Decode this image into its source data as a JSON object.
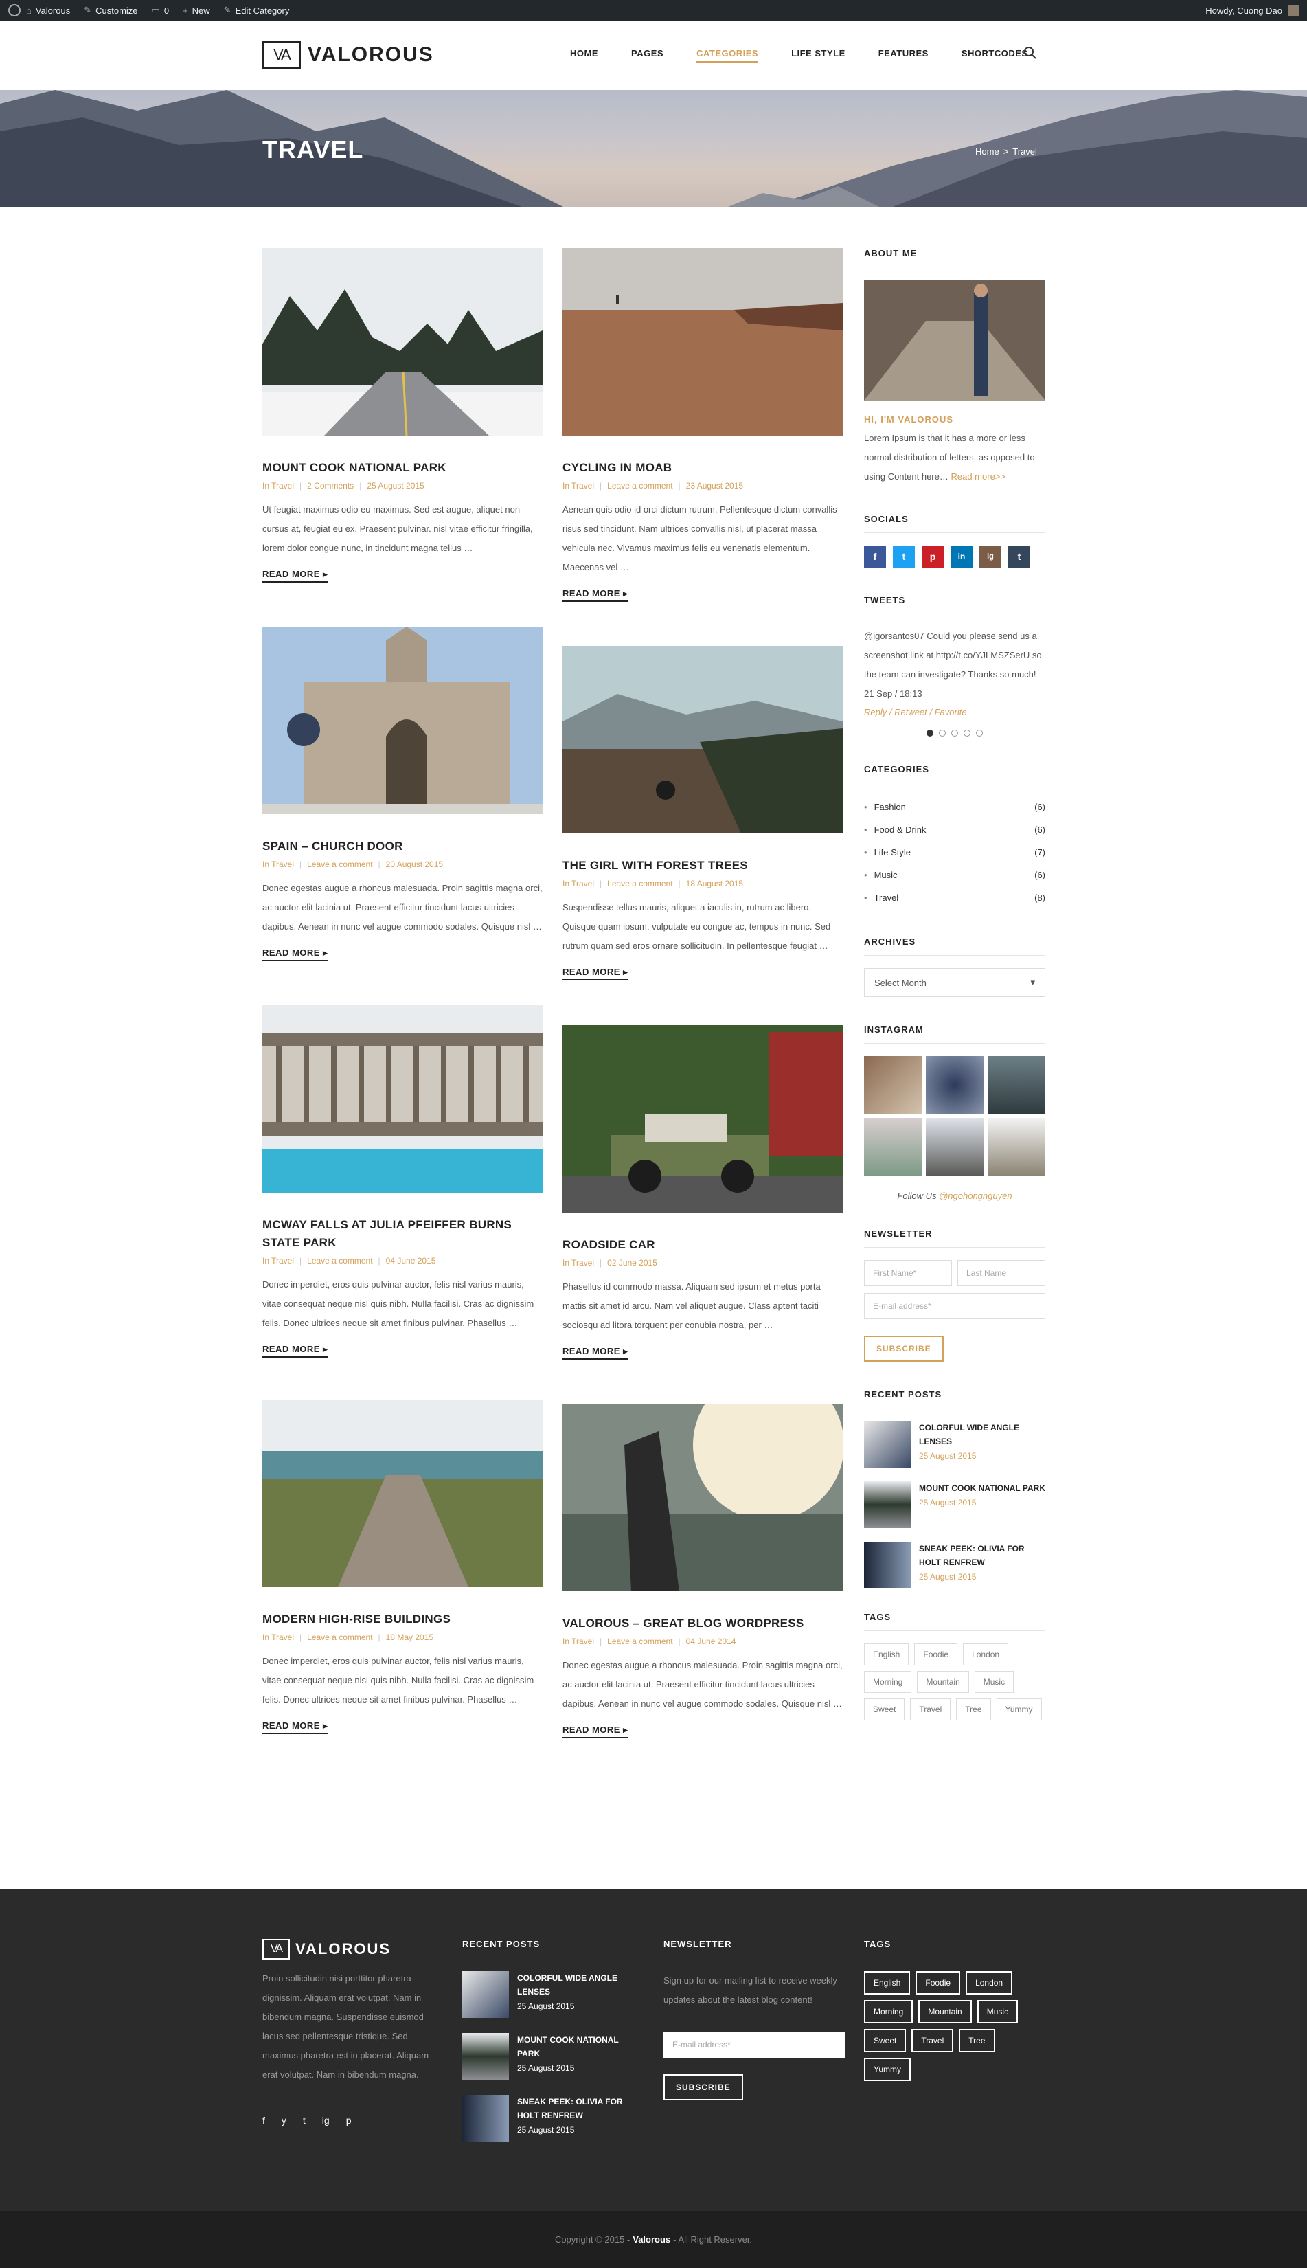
{
  "adminbar": {
    "site": "Valorous",
    "customize": "Customize",
    "comments": "0",
    "new": "New",
    "edit": "Edit Category",
    "howdy": "Howdy, Cuong Dao"
  },
  "header": {
    "logo_mark": "VA",
    "logo_text": "VALOROUS",
    "nav": [
      "HOME",
      "PAGES",
      "CATEGORIES",
      "LIFE STYLE",
      "FEATURES",
      "SHORTCODES"
    ],
    "active": "CATEGORIES"
  },
  "hero": {
    "title": "TRAVEL",
    "crumb_home": "Home",
    "crumb_sep": ">",
    "crumb_current": "Travel"
  },
  "posts": [
    {
      "title": "MOUNT COOK NATIONAL PARK",
      "cat": "In Travel",
      "comments": "2 Comments",
      "date": "25 August 2015",
      "excerpt": "Ut feugiat maximus odio eu maximus. Sed est augue, aliquet non cursus at, feugiat eu ex. Praesent pulvinar. nisl vitae efficitur fringilla, lorem dolor congue nunc, in tincidunt magna tellus …",
      "more": "READ MORE"
    },
    {
      "title": "CYCLING IN MOAB",
      "cat": "In Travel",
      "comments": "Leave a comment",
      "date": "23 August 2015",
      "excerpt": "Aenean quis odio id orci dictum rutrum. Pellentesque dictum convallis risus sed tincidunt. Nam ultrices convallis nisl, ut placerat massa vehicula nec. Vivamus maximus felis eu venenatis elementum. Maecenas vel …",
      "more": "READ MORE"
    },
    {
      "title": "SPAIN – CHURCH DOOR",
      "cat": "In Travel",
      "comments": "Leave a comment",
      "date": "20 August 2015",
      "excerpt": "Donec egestas augue a rhoncus malesuada. Proin sagittis magna orci, ac auctor elit lacinia ut. Praesent efficitur tincidunt lacus ultricies dapibus. Aenean in nunc vel augue commodo sodales. Quisque nisl …",
      "more": "READ MORE"
    },
    {
      "title": "THE GIRL WITH FOREST TREES",
      "cat": "In Travel",
      "comments": "Leave a comment",
      "date": "18 August 2015",
      "excerpt": "Suspendisse tellus mauris, aliquet a iaculis in, rutrum ac libero. Quisque quam ipsum, vulputate eu congue ac, tempus in nunc. Sed rutrum quam sed eros ornare sollicitudin. In pellentesque feugiat …",
      "more": "READ MORE"
    },
    {
      "title": "MCWAY FALLS AT JULIA PFEIFFER BURNS STATE PARK",
      "cat": "In Travel",
      "comments": "Leave a comment",
      "date": "04 June 2015",
      "excerpt": "Donec imperdiet, eros quis pulvinar auctor, felis nisl varius mauris, vitae consequat neque nisl quis nibh. Nulla facilisi. Cras ac dignissim felis. Donec ultrices neque sit amet finibus pulvinar. Phasellus …",
      "more": "READ MORE"
    },
    {
      "title": "ROADSIDE CAR",
      "cat": "In Travel",
      "comments": "",
      "date": "02 June 2015",
      "excerpt": "Phasellus id commodo massa. Aliquam sed ipsum et metus porta mattis sit amet id arcu. Nam vel aliquet augue. Class aptent taciti sociosqu ad litora torquent per conubia nostra, per …",
      "more": "READ MORE"
    },
    {
      "title": "MODERN HIGH-RISE BUILDINGS",
      "cat": "In Travel",
      "comments": "Leave a comment",
      "date": "18 May 2015",
      "excerpt": "Donec imperdiet, eros quis pulvinar auctor, felis nisl varius mauris, vitae consequat neque nisl quis nibh. Nulla facilisi. Cras ac dignissim felis. Donec ultrices neque sit amet finibus pulvinar. Phasellus …",
      "more": "READ MORE"
    },
    {
      "title": "VALOROUS – GREAT BLOG WORDPRESS",
      "cat": "In Travel",
      "comments": "Leave a comment",
      "date": "04 June 2014",
      "excerpt": "Donec egestas augue a rhoncus malesuada. Proin sagittis magna orci, ac auctor elit lacinia ut. Praesent efficitur tincidunt lacus ultricies dapibus. Aenean in nunc vel augue commodo sodales. Quisque nisl …",
      "more": "READ MORE"
    }
  ],
  "sidebar": {
    "about_title": "ABOUT ME",
    "about_heading": "HI, I'M VALOROUS",
    "about_text": "Lorem Ipsum is that it has a more or less normal distribution of letters, as opposed to using Content here…",
    "about_link": "Read more>>",
    "socials_title": "SOCIALS",
    "socials": [
      "f",
      "t",
      "p",
      "in",
      "ig",
      "t"
    ],
    "tweets_title": "TWEETS",
    "tweet_text": "@igorsantos07 Could you please send us a screenshot link at http://t.co/YJLMSZSerU so the team can investigate? Thanks so much!",
    "tweet_date": "21 Sep / 18:13",
    "tweet_actions": "Reply / Retweet / Favorite",
    "categories_title": "CATEGORIES",
    "categories": [
      {
        "name": "Fashion",
        "count": "(6)"
      },
      {
        "name": "Food & Drink",
        "count": "(6)"
      },
      {
        "name": "Life Style",
        "count": "(7)"
      },
      {
        "name": "Music",
        "count": "(6)"
      },
      {
        "name": "Travel",
        "count": "(8)"
      }
    ],
    "archives_title": "ARCHIVES",
    "archives_select": "Select Month",
    "instagram_title": "INSTAGRAM",
    "follow_prefix": "Follow Us",
    "follow_handle": "@ngohongnguyen",
    "newsletter_title": "NEWSLETTER",
    "first_name": "First Name*",
    "last_name": "Last Name",
    "email": "E-mail address*",
    "subscribe": "SUBSCRIBE",
    "recent_title": "RECENT POSTS",
    "recent": [
      {
        "title": "COLORFUL WIDE ANGLE LENSES",
        "date": "25 August 2015"
      },
      {
        "title": "MOUNT COOK NATIONAL PARK",
        "date": "25 August 2015"
      },
      {
        "title": "SNEAK PEEK: OLIVIA FOR HOLT RENFREW",
        "date": "25 August 2015"
      }
    ],
    "tags_title": "TAGS",
    "tags": [
      "English",
      "Foodie",
      "London",
      "Morning",
      "Mountain",
      "Music",
      "Sweet",
      "Travel",
      "Tree",
      "Yummy"
    ]
  },
  "footer": {
    "logo_mark": "VA",
    "logo_text": "VALOROUS",
    "about": "Proin sollicitudin nisi porttitor pharetra dignissim. Aliquam erat volutpat. Nam in bibendum magna. Suspendisse euismod lacus sed pellentesque tristique. Sed maximus pharetra est in placerat. Aliquam erat volutpat. Nam in bibendum magna.",
    "social": [
      "f",
      "y",
      "t",
      "ig",
      "p"
    ],
    "recent_title": "RECENT POSTS",
    "recent": [
      {
        "title": "COLORFUL WIDE ANGLE LENSES",
        "date": "25 August 2015"
      },
      {
        "title": "MOUNT COOK NATIONAL PARK",
        "date": "25 August 2015"
      },
      {
        "title": "SNEAK PEEK: OLIVIA FOR HOLT RENFREW",
        "date": "25 August 2015"
      }
    ],
    "newsletter_title": "NEWSLETTER",
    "newsletter_text": "Sign up for our mailing list to receive weekly updates about the latest blog content!",
    "email": "E-mail address*",
    "subscribe": "SUBSCRIBE",
    "tags_title": "TAGS",
    "tags": [
      "English",
      "Foodie",
      "London",
      "Morning",
      "Mountain",
      "Music",
      "Sweet",
      "Travel",
      "Tree",
      "Yummy"
    ],
    "copyright_pre": "Copyright © 2015 -",
    "copyright_brand": "Valorous",
    "copyright_post": "- All Right Reserver."
  }
}
